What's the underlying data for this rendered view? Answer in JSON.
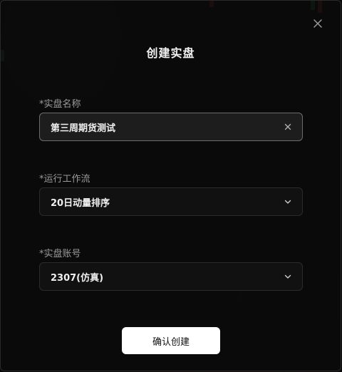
{
  "modal": {
    "title": "创建实盘",
    "close_icon": "close-icon",
    "fields": {
      "name": {
        "label": "*实盘名称",
        "value": "第三周期货测试",
        "icon": "clear-icon"
      },
      "workflow": {
        "label": "*运行工作流",
        "value": "20日动量排序",
        "icon": "chevron-down-icon"
      },
      "account": {
        "label": "*实盘账号",
        "value": "2307(仿真)",
        "icon": "chevron-down-icon"
      }
    },
    "submit_label": "确认创建"
  },
  "colors": {
    "accent_red": "#c23a4a",
    "accent_green": "#2e9e6a",
    "button_bg": "#ffffff"
  }
}
